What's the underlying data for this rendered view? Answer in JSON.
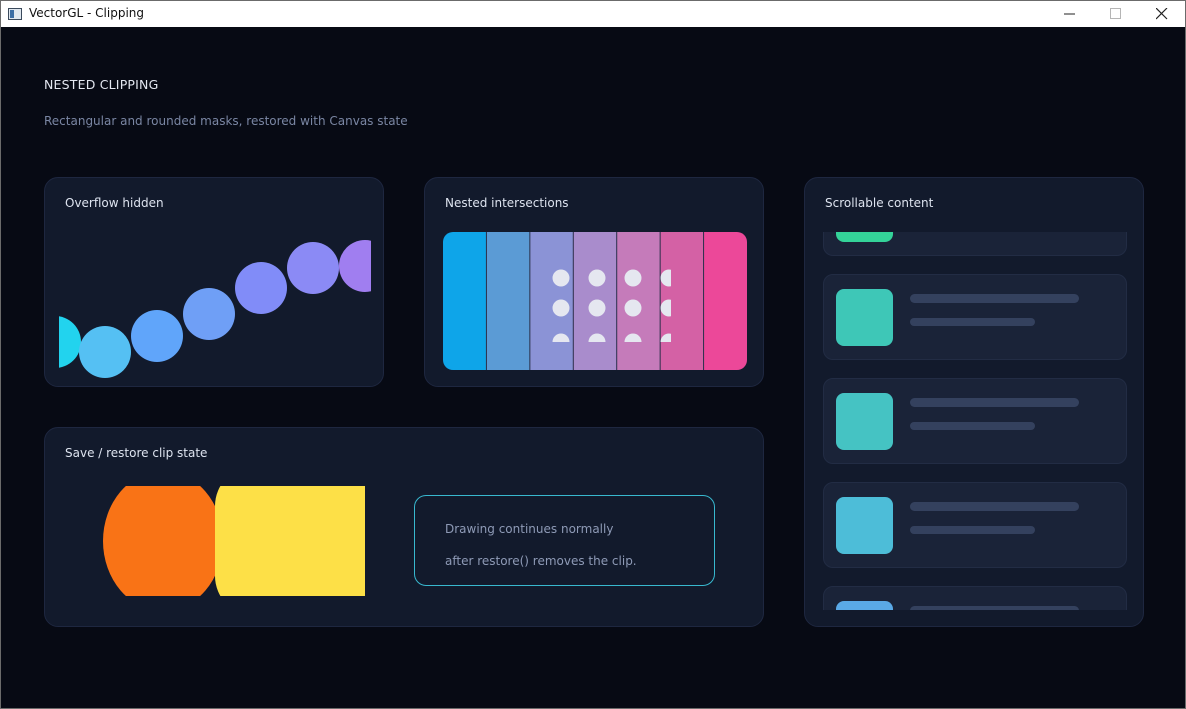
{
  "window": {
    "title": "VectorGL - Clipping",
    "controls": {
      "minimize": "minimize-icon",
      "maximize": "maximize-icon",
      "close": "close-icon"
    }
  },
  "page": {
    "title": "NESTED CLIPPING",
    "subtitle": "Rectangular and rounded masks, restored with Canvas state"
  },
  "cards": {
    "overflow": {
      "title": "Overflow hidden",
      "ball_colors": [
        "#22d3ee",
        "#55c0f3",
        "#60a5fa",
        "#6f9ff6",
        "#818cf8",
        "#8b8af5",
        "#a07ef0"
      ]
    },
    "nested": {
      "title": "Nested intersections",
      "stripe_colors": [
        "#0ea5e9",
        "#5b9bd5",
        "#8b93d6",
        "#a98ccc",
        "#c57bba",
        "#d461a5",
        "#ec4899"
      ],
      "dot_color": "#e5e7f0"
    },
    "save_restore": {
      "title": "Save / restore clip state",
      "shape_colors": {
        "left": "#f97316",
        "right": "#fde047"
      },
      "message_line_1": "Drawing continues normally",
      "message_line_2": "after restore() removes the clip.",
      "accent": "#38b8cf"
    },
    "scrollable": {
      "title": "Scrollable content",
      "items": [
        {
          "thumb_color": "#34d399"
        },
        {
          "thumb_color": "#3ec7b7"
        },
        {
          "thumb_color": "#45c3c3"
        },
        {
          "thumb_color": "#4dbdd8"
        },
        {
          "thumb_color": "#5aa9e6"
        }
      ]
    }
  }
}
